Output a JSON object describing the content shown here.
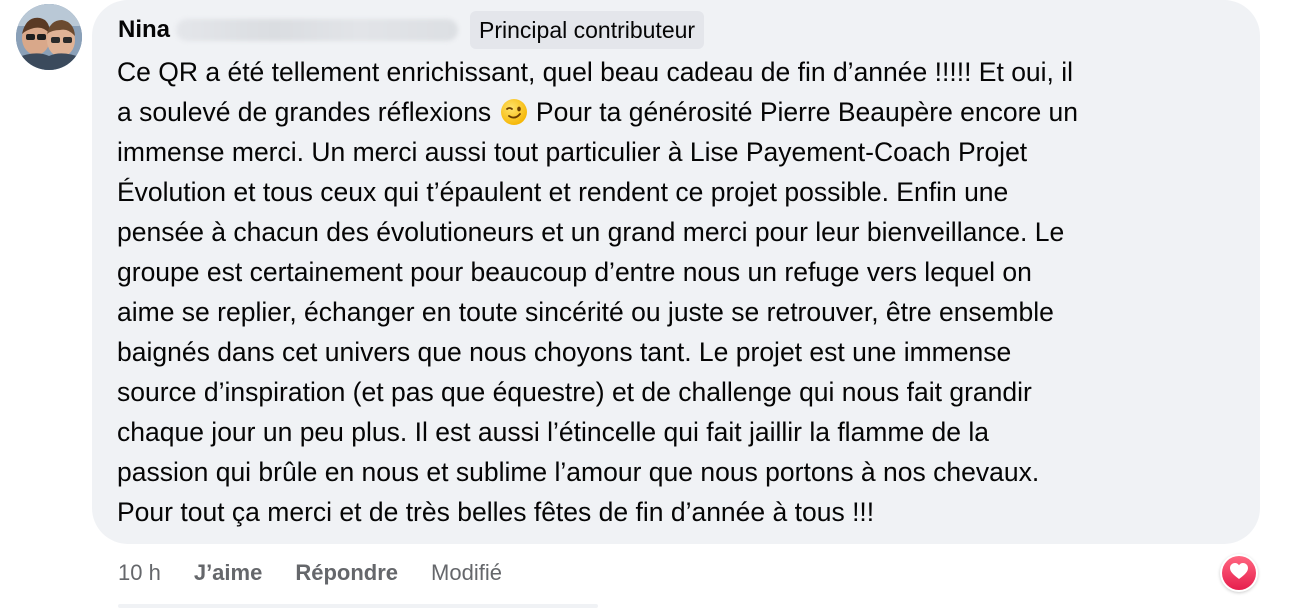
{
  "comment": {
    "author": "Nina",
    "badge": "Principal contributeur",
    "text_before_emoji": "Ce QR a été tellement enrichissant, quel beau cadeau de fin d’année !!!!! Et oui, il\na soulevé de grandes réflexions ",
    "emoji": "winking-face",
    "text_after_emoji": " Pour ta générosité Pierre Beaupère encore un\nimmense merci. Un merci aussi tout particulier à Lise Payement-Coach Projet\nÉvolution et tous ceux qui t’épaulent et rendent ce projet possible. Enfin une\npensée à chacun des évolutioneurs et un grand merci pour leur bienveillance. Le\ngroupe est certainement pour beaucoup d’entre nous un refuge vers lequel on\naime se replier, échanger en toute sincérité ou juste se retrouver, être ensemble\nbaignés dans cet univers que nous choyons tant. Le projet est une immense\nsource d’inspiration (et pas que équestre) et de challenge qui nous fait grandir\nchaque jour un peu plus. Il est aussi l’étincelle qui fait jaillir la flamme de la\npassion qui brûle en nous et sublime l’amour que nous portons à nos chevaux.\nPour tout ça merci et de très belles fêtes de fin d’année à tous !!!"
  },
  "actions": {
    "time": "10 h",
    "like": "J’aime",
    "reply": "Répondre",
    "edited": "Modifié"
  },
  "reaction": {
    "type": "love",
    "icon": "heart-icon"
  },
  "colors": {
    "bubble_bg": "#f0f2f5",
    "badge_bg": "#e4e6eb",
    "secondary_text": "#65676b",
    "love_red": "#f33e58"
  }
}
